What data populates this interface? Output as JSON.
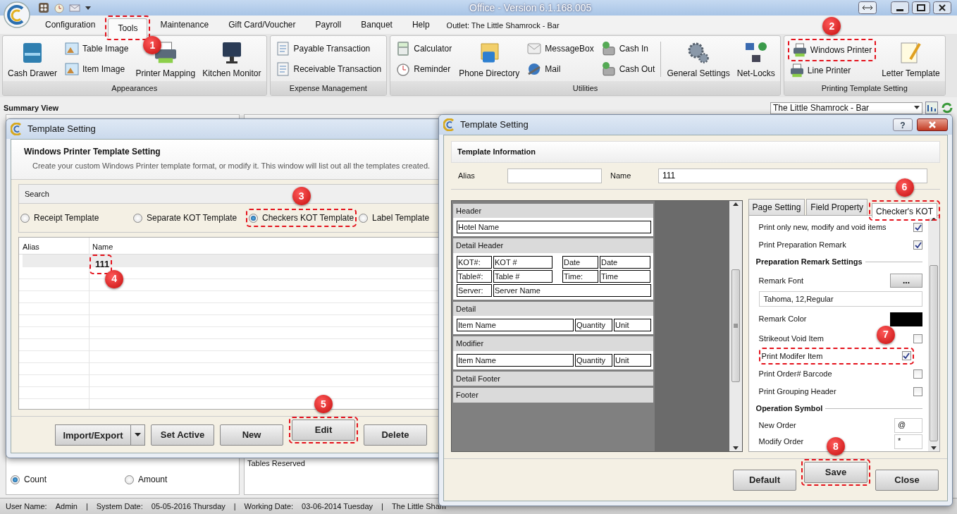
{
  "window": {
    "title": "Office - Version 6.1.168.005"
  },
  "menu": [
    {
      "label": "Configuration",
      "selected": false
    },
    {
      "label": "Tools",
      "selected": true,
      "callout": "1"
    },
    {
      "label": "Maintenance",
      "selected": false
    },
    {
      "label": "Gift Card/Voucher",
      "selected": false
    },
    {
      "label": "Payroll",
      "selected": false
    },
    {
      "label": "Banquet",
      "selected": false
    },
    {
      "label": "Help",
      "selected": false
    }
  ],
  "outlet_label": "Outlet: The Little Shamrock - Bar",
  "ribbon": [
    {
      "title": "Appearances",
      "columns": [
        {
          "kind": "large",
          "items": [
            {
              "label": "Cash Drawer"
            }
          ]
        },
        {
          "kind": "stack",
          "items": [
            {
              "label": "Table Image"
            },
            {
              "label": "Item Image"
            }
          ]
        },
        {
          "kind": "large",
          "items": [
            {
              "label": "Printer Mapping"
            }
          ]
        },
        {
          "kind": "large",
          "items": [
            {
              "label": "Kitchen Monitor"
            }
          ]
        }
      ]
    },
    {
      "title": "Expense Management",
      "columns": [
        {
          "kind": "stack",
          "items": [
            {
              "label": "Payable Transaction"
            },
            {
              "label": "Receivable Transaction"
            }
          ]
        }
      ]
    },
    {
      "title": "Utilities",
      "columns": [
        {
          "kind": "stack",
          "items": [
            {
              "label": "Calculator"
            },
            {
              "label": "Reminder"
            }
          ]
        },
        {
          "kind": "large",
          "items": [
            {
              "label": "Phone Directory"
            }
          ]
        },
        {
          "kind": "stack",
          "items": [
            {
              "label": "MessageBox"
            },
            {
              "label": "Mail"
            }
          ]
        },
        {
          "kind": "stack",
          "items": [
            {
              "label": "Cash In"
            },
            {
              "label": "Cash Out"
            }
          ]
        },
        {
          "kind": "separator"
        },
        {
          "kind": "large",
          "items": [
            {
              "label": "General Settings"
            }
          ]
        },
        {
          "kind": "large",
          "items": [
            {
              "label": "Net-Locks"
            }
          ]
        }
      ]
    },
    {
      "title": "Printing Template Setting",
      "columns": [
        {
          "kind": "stack",
          "items": [
            {
              "label": "Windows Printer",
              "callout": "2"
            },
            {
              "label": "Line Printer"
            }
          ]
        },
        {
          "kind": "large",
          "items": [
            {
              "label": "Letter Template"
            }
          ]
        }
      ]
    }
  ],
  "summary": {
    "title": "Summary View",
    "outlet": "The Little Shamrock - Bar"
  },
  "background": {
    "tables_label": "Tables Reserved",
    "radios": [
      {
        "label": "Count",
        "selected": true
      },
      {
        "label": "Amount",
        "selected": false
      }
    ]
  },
  "status_bar": [
    "User Name:",
    "Admin",
    "|",
    "System Date:",
    "05-05-2016 Thursday",
    "|",
    "Working Date:",
    "03-06-2014 Tuesday",
    "|",
    "The Little Sham"
  ],
  "list_dialog": {
    "title": "Template Setting",
    "heading": "Windows Printer Template Setting",
    "description": "Create your custom Windows Printer template format, or modify it. This window will list out all the templates created.",
    "search": {
      "title": "Search",
      "options": [
        {
          "label": "Receipt Template",
          "selected": false
        },
        {
          "label": "Separate KOT Template",
          "selected": false
        },
        {
          "label": "Checkers KOT Template",
          "selected": true,
          "callout": "3"
        },
        {
          "label": "Label Template",
          "selected": false
        }
      ]
    },
    "table": {
      "columns": [
        "Alias",
        "Name"
      ],
      "rows": [
        {
          "name": "111",
          "selected": true,
          "callout": "4"
        }
      ]
    },
    "buttons": [
      {
        "label": "Import/Export",
        "kind": "split"
      },
      {
        "label": "Set Active",
        "kind": "plain"
      },
      {
        "label": "New",
        "kind": "plain"
      },
      {
        "label": "Edit",
        "kind": "plain",
        "callout": "5"
      },
      {
        "label": "Delete",
        "kind": "plain"
      }
    ]
  },
  "edit_dialog": {
    "title": "Template Setting",
    "help": "?",
    "section": "Template Information",
    "fields": [
      {
        "label": "Alias"
      },
      {
        "label": "Name",
        "value": "111"
      }
    ],
    "preview": [
      {
        "title": "Header",
        "rows": [
          [
            "Hotel Name"
          ]
        ]
      },
      {
        "title": "Detail Header",
        "rows": [
          [
            "KOT#:",
            "KOT #",
            "Date",
            "Date"
          ],
          [
            "Table#:",
            "Table #",
            "Time:",
            "Time"
          ],
          [
            "Server:",
            "Server Name"
          ]
        ]
      },
      {
        "title": "Detail",
        "rows": [
          [
            "Item Name",
            "Quantity",
            "Unit"
          ]
        ]
      },
      {
        "title": "Modifier",
        "rows": [
          [
            "Item Name",
            "Quantity",
            "Unit"
          ]
        ]
      },
      {
        "title": "Detail Footer"
      },
      {
        "title": "Footer"
      }
    ],
    "tabs": [
      {
        "label": "Page Setting",
        "selected": false
      },
      {
        "label": "Field Property",
        "selected": false
      },
      {
        "label": "Checker's KOT",
        "selected": true,
        "callout": "6"
      }
    ],
    "settings": [
      {
        "kind": "checkbox",
        "label": "Print only new, modify and void items",
        "checked": true
      },
      {
        "kind": "checkbox",
        "label": "Print Preparation Remark",
        "checked": true
      },
      {
        "kind": "heading",
        "label": "Preparation Remark Settings"
      },
      {
        "kind": "button",
        "label": "Remark Font",
        "button": "..."
      },
      {
        "kind": "text",
        "value": "Tahoma, 12,Regular"
      },
      {
        "kind": "color",
        "label": "Remark Color",
        "color": "#000000"
      },
      {
        "kind": "checkbox",
        "label": "Strikeout Void Item",
        "checked": false
      },
      {
        "kind": "checkbox",
        "label": "Print Modifer Item",
        "checked": true,
        "callout": "7"
      },
      {
        "kind": "checkbox",
        "label": "Print Order# Barcode",
        "checked": false
      },
      {
        "kind": "checkbox",
        "label": "Print Grouping Header",
        "checked": false
      },
      {
        "kind": "heading",
        "label": "Operation Symbol"
      },
      {
        "kind": "symbol",
        "label": "New Order",
        "value": "@"
      },
      {
        "kind": "symbol",
        "label": "Modify Order",
        "value": "*"
      }
    ],
    "buttons": [
      {
        "label": "Default"
      },
      {
        "label": "Save",
        "callout": "8"
      },
      {
        "label": "Close"
      }
    ]
  }
}
